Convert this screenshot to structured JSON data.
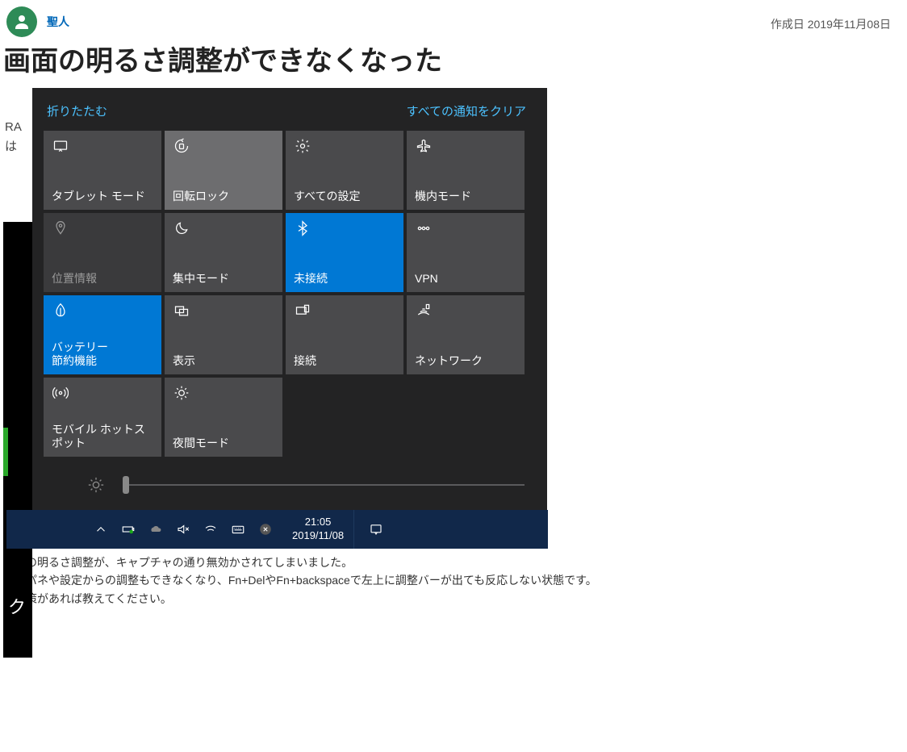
{
  "post": {
    "author": "聖人",
    "created_label": "作成日 2019年11月08日",
    "title": "画面の明るさ調整ができなくなった",
    "body_cut_left1": "RA",
    "body_cut_left2": "は",
    "body_cut_dark": "ク",
    "paragraphs": [
      "画面の明るさ調整が、キャプチャの通り無効かされてしまいました。",
      "コンパネや設定からの調整もできなくなり、Fn+DelやFn+backspaceで左上に調整バーが出ても反応しない状態です。",
      "解決策があれば教えてください。"
    ]
  },
  "action_center": {
    "collapse": "折りたたむ",
    "clear_all": "すべての通知をクリア",
    "tiles": [
      {
        "name": "tablet-mode",
        "label": "タブレット モード",
        "state": "normal"
      },
      {
        "name": "rotation-lock",
        "label": "回転ロック",
        "state": "light"
      },
      {
        "name": "all-settings",
        "label": "すべての設定",
        "state": "normal"
      },
      {
        "name": "airplane-mode",
        "label": "機内モード",
        "state": "normal"
      },
      {
        "name": "location",
        "label": "位置情報",
        "state": "dim"
      },
      {
        "name": "focus-assist",
        "label": "集中モード",
        "state": "normal"
      },
      {
        "name": "bluetooth",
        "label": "未接続",
        "state": "active"
      },
      {
        "name": "vpn",
        "label": "VPN",
        "state": "normal"
      },
      {
        "name": "battery-saver",
        "label": "バッテリー\n節約機能",
        "state": "active"
      },
      {
        "name": "project",
        "label": "表示",
        "state": "normal"
      },
      {
        "name": "connect",
        "label": "接続",
        "state": "normal"
      },
      {
        "name": "network",
        "label": "ネットワーク",
        "state": "normal"
      },
      {
        "name": "mobile-hotspot",
        "label": "モバイル ホットスポット",
        "state": "normal"
      },
      {
        "name": "night-light",
        "label": "夜間モード",
        "state": "normal"
      }
    ]
  },
  "taskbar": {
    "time": "21:05",
    "date": "2019/11/08"
  }
}
